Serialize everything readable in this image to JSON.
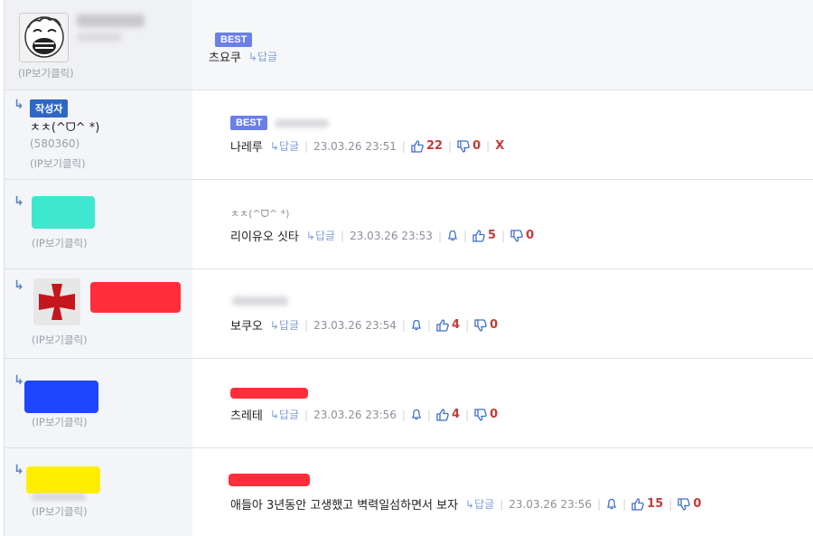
{
  "ip_label": "(IP보기클릭)",
  "reply_label": "↳답글",
  "best_label": "BEST",
  "author_label": "작성자",
  "comments": [
    {
      "nickname": "",
      "text": "츠요쿠"
    },
    {
      "nickname": "ㅊㅊ(^ᗜ^ *)",
      "count": "(580360)",
      "text": "나레루",
      "date": "23.03.26 23:51",
      "up": "22",
      "down": "0",
      "delete": "X"
    },
    {
      "quote": "ㅊㅊ(^ᗜ^ *)",
      "text": "리이유오 싯타",
      "date": "23.03.26 23:53",
      "up": "5",
      "down": "0"
    },
    {
      "text": "보쿠오",
      "date": "23.03.26 23:54",
      "up": "4",
      "down": "0"
    },
    {
      "text": "츠레테",
      "date": "23.03.26 23:56",
      "up": "4",
      "down": "0"
    },
    {
      "text": "애들아 3년동안 고생했고 벽력일섬하면서 보자",
      "date": "23.03.26 23:56",
      "up": "15",
      "down": "0"
    }
  ],
  "colors": {
    "best_badge": "#6b7fe6",
    "author_badge": "#2f67c8",
    "redact_cyan": "#3de8cf",
    "redact_red": "#ff2e3a",
    "redact_blue": "#1e46ff",
    "redact_yellow": "#ffee00",
    "vote_number": "#c23b3b"
  },
  "icons": {
    "reply": "reply-arrow-icon",
    "up": "thumbs-up-icon",
    "down": "thumbs-down-icon",
    "alert": "bell-icon"
  }
}
